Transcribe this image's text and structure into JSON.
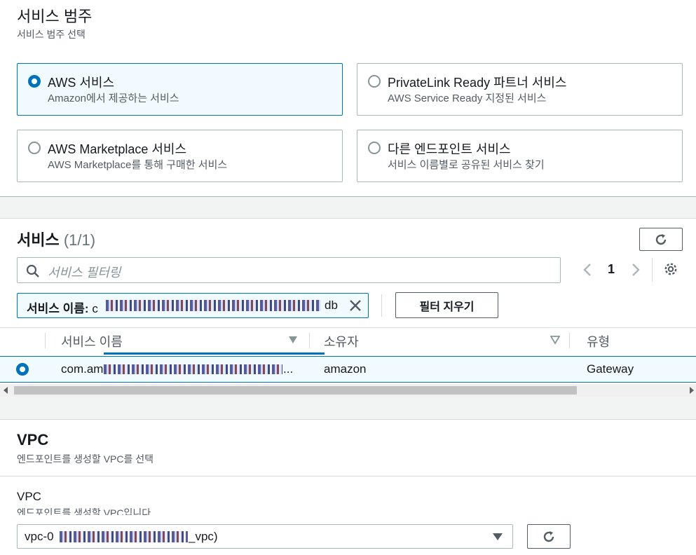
{
  "category": {
    "title": "서비스 범주",
    "subtitle": "서비스 범주 선택",
    "options": [
      {
        "label": "AWS 서비스",
        "desc": "Amazon에서 제공하는 서비스",
        "selected": true
      },
      {
        "label": "PrivateLink Ready 파트너 서비스",
        "desc": "AWS Service Ready 지정된 서비스",
        "selected": false
      },
      {
        "label": "AWS Marketplace 서비스",
        "desc": "AWS Marketplace를 통해 구매한 서비스",
        "selected": false
      },
      {
        "label": "다른 엔드포인트 서비스",
        "desc": "서비스 이름별로 공유된 서비스 찾기",
        "selected": false
      }
    ]
  },
  "services": {
    "title": "서비스",
    "count": "(1/1)",
    "search_placeholder": "서비스 필터링",
    "page": "1",
    "token_label": "서비스 이름:",
    "token_value_start": "c",
    "token_value_end": "db",
    "clear_filters": "필터 지우기",
    "columns": [
      "서비스 이름",
      "소유자",
      "유형"
    ],
    "rows": [
      {
        "name_start": "com.am",
        "name_end": "...",
        "owner": "amazon",
        "type": "Gateway",
        "selected": true
      }
    ]
  },
  "vpc": {
    "title": "VPC",
    "subtitle": "엔드포인트를 생성할 VPC를 선택",
    "field_label": "VPC",
    "field_desc": "엔드포인트를 생성할 VPC입니다",
    "value_start": "vpc-0",
    "value_end": "_vpc)"
  },
  "colors": {
    "accent": "#0073bb",
    "band": "#f2f3f3",
    "selected_bg": "#f1faff"
  }
}
